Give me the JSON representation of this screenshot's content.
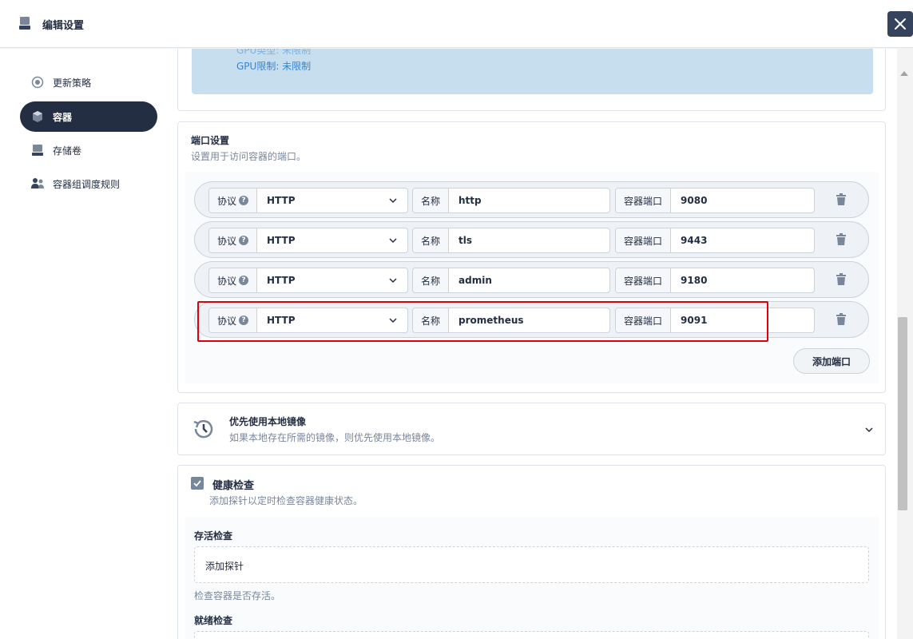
{
  "header": {
    "title": "编辑设置"
  },
  "sidebar": {
    "items": [
      {
        "label": "更新策略",
        "icon": "update-strategy-icon"
      },
      {
        "label": "容器",
        "icon": "container-icon",
        "active": true
      },
      {
        "label": "存储卷",
        "icon": "storage-volume-icon"
      },
      {
        "label": "容器组调度规则",
        "icon": "scheduling-rule-icon"
      }
    ]
  },
  "gpu": {
    "type_line": "GPU类型:  未限制",
    "limit_line": "GPU限制:  未限制"
  },
  "ports": {
    "title": "端口设置",
    "desc": "设置用于访问容器的端口。",
    "protocol_label": "协议",
    "name_label": "名称",
    "port_label": "容器端口",
    "rows": [
      {
        "protocol": "HTTP",
        "name": "http",
        "port": "9080"
      },
      {
        "protocol": "HTTP",
        "name": "tls",
        "port": "9443"
      },
      {
        "protocol": "HTTP",
        "name": "admin",
        "port": "9180"
      },
      {
        "protocol": "HTTP",
        "name": "prometheus",
        "port": "9091"
      }
    ],
    "add_button": "添加端口"
  },
  "local_image": {
    "title": "优先使用本地镜像",
    "desc": "如果本地存在所需的镜像，则优先使用本地镜像。"
  },
  "health": {
    "title": "健康检查",
    "desc": "添加探针以定时检查容器健康状态。",
    "checked": true,
    "liveness": {
      "title": "存活检查",
      "add_probe": "添加探针",
      "desc": "检查容器是否存活。"
    },
    "readiness": {
      "title": "就绪检查"
    }
  },
  "colors": {
    "dark": "#242e42",
    "highlight": "#e0000c",
    "gpu_bg": "#c7deef",
    "gpu_text": "#3385d6"
  }
}
